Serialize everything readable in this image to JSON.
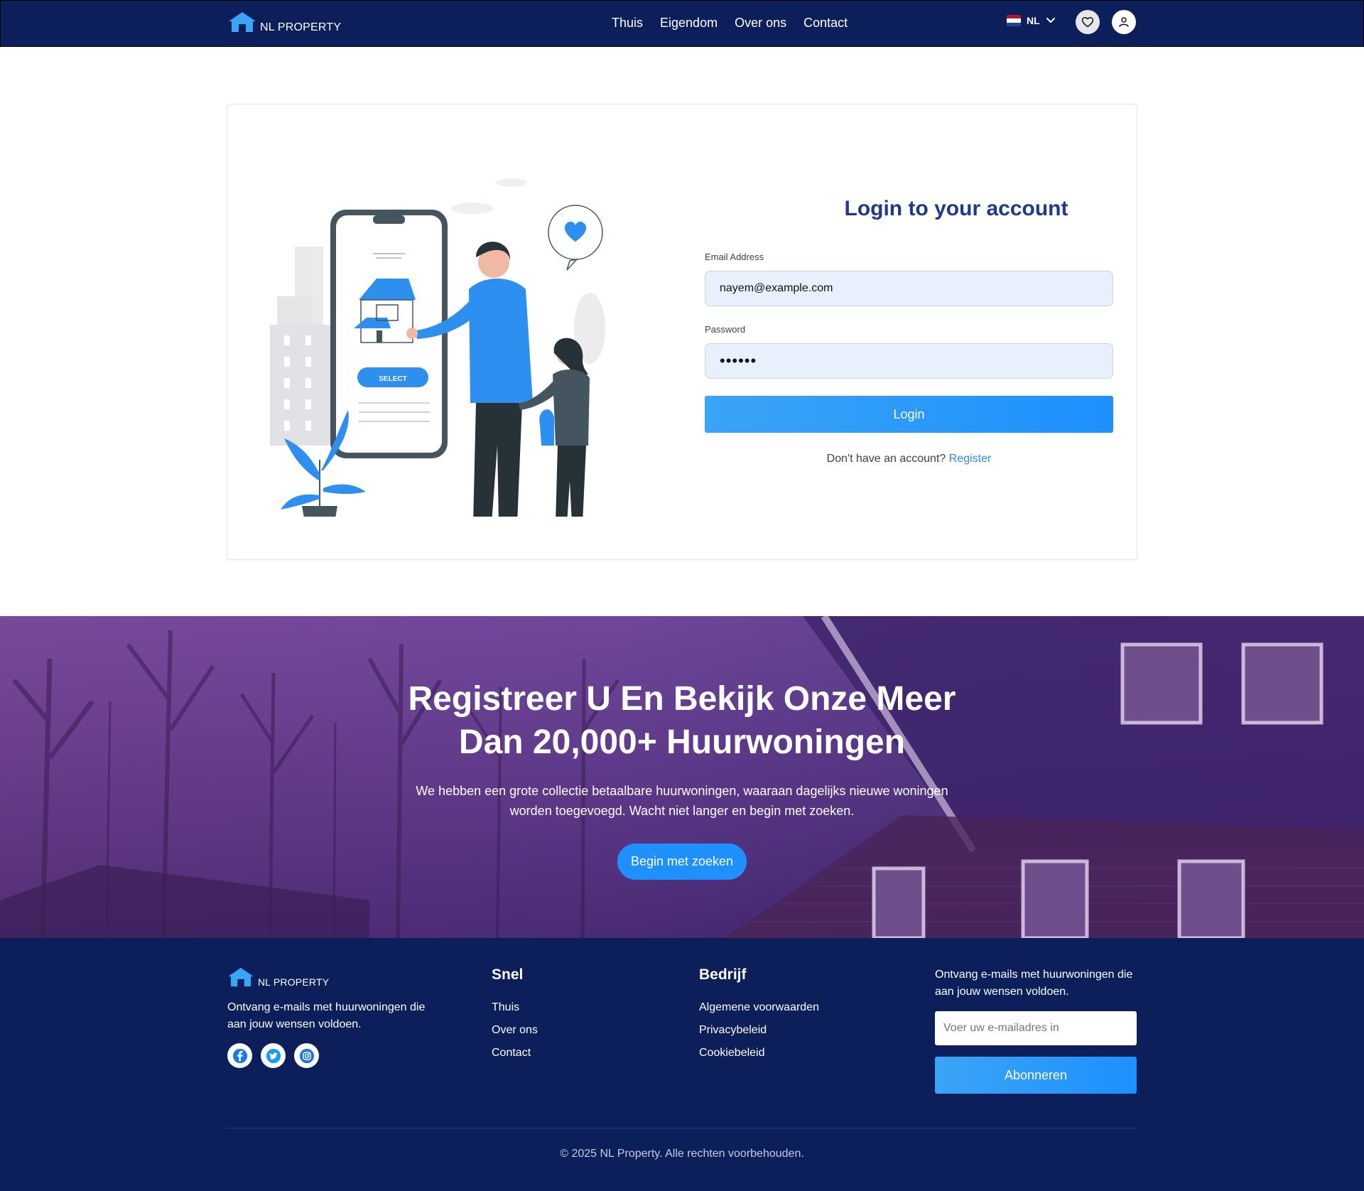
{
  "brand": {
    "name": "NL PROPERTY"
  },
  "nav": {
    "items": [
      "Thuis",
      "Eigendom",
      "Over ons",
      "Contact"
    ]
  },
  "language": {
    "code": "NL",
    "flag_colors": [
      "#ae1c28",
      "#ffffff",
      "#21468b"
    ]
  },
  "colors": {
    "navy": "#0c1f5a",
    "accent": "#1e90ff",
    "title": "#1e3a8a",
    "link": "#2a8be8"
  },
  "login": {
    "title": "Login to your account",
    "email_label": "Email Address",
    "email_value": "nayem@example.com",
    "password_label": "Password",
    "password_value": "••••••",
    "button": "Login",
    "signup_prompt": "Don't have an account?",
    "signup_link": "Register"
  },
  "illustration": {
    "select_label": "SELECT"
  },
  "hero": {
    "title_line1": "Registreer U En Bekijk Onze Meer",
    "title_line2": "Dan 20,000+ Huurwoningen",
    "subtitle_line1": "We hebben een grote collectie betaalbare huurwoningen, waaraan dagelijks nieuwe woningen",
    "subtitle_line2": "worden toegevoegd. Wacht niet langer en begin met zoeken.",
    "button": "Begin met zoeken"
  },
  "footer": {
    "description": "Ontvang e-mails met huurwoningen die aan jouw wensen voldoen.",
    "socials": [
      "facebook-icon",
      "twitter-icon",
      "instagram-icon"
    ],
    "quick": {
      "title": "Snel",
      "links": [
        "Thuis",
        "Over ons",
        "Contact"
      ]
    },
    "company": {
      "title": "Bedrijf",
      "links": [
        "Algemene voorwaarden",
        "Privacybeleid",
        "Cookiebeleid"
      ]
    },
    "newsletter": {
      "text": "Ontvang e-mails met huurwoningen die aan jouw wensen voldoen.",
      "placeholder": "Voer uw e-mailadres in",
      "button": "Abonneren"
    },
    "copyright": "© 2025 NL Property. Alle rechten voorbehouden."
  }
}
